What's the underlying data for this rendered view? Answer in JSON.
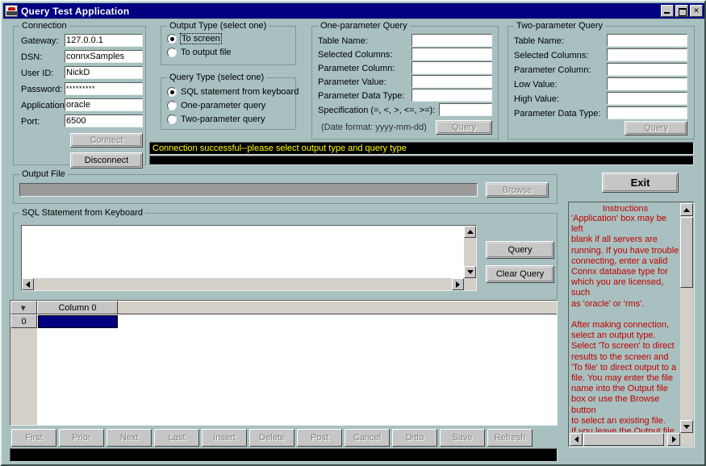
{
  "window": {
    "title": "Query Test Application",
    "icon": "app-icon",
    "buttons": {
      "minimize": "_",
      "maximize": "□",
      "close": "✕"
    }
  },
  "connection": {
    "legend": "Connection",
    "fields": [
      {
        "label": "Gateway:",
        "value": "127.0.0.1"
      },
      {
        "label": "DSN:",
        "value": "connxSamples"
      },
      {
        "label": "User ID:",
        "value": "NickD"
      },
      {
        "label": "Password:",
        "value": "*********"
      },
      {
        "label": "Application:",
        "value": "oracle"
      },
      {
        "label": "Port:",
        "value": "6500"
      }
    ],
    "connect_label": "Connect",
    "disconnect_label": "Disconnect"
  },
  "output_type": {
    "legend": "Output Type (select one)",
    "options": [
      {
        "label": "To screen",
        "checked": true,
        "focused": true
      },
      {
        "label": "To output file",
        "checked": false,
        "focused": false
      }
    ]
  },
  "query_type": {
    "legend": "Query Type (select one)",
    "options": [
      {
        "label": "SQL statement from keyboard",
        "checked": true
      },
      {
        "label": "One-parameter query",
        "checked": false
      },
      {
        "label": "Two-parameter query",
        "checked": false
      }
    ]
  },
  "one_param": {
    "legend": "One-parameter Query",
    "fields": [
      {
        "label": "Table Name:",
        "value": ""
      },
      {
        "label": "Selected Columns:",
        "value": ""
      },
      {
        "label": "Parameter Column:",
        "value": ""
      },
      {
        "label": "Parameter Value:",
        "value": ""
      },
      {
        "label": "Parameter Data Type:",
        "value": ""
      }
    ],
    "spec_label": "Specification (=, <, >, <=, >=):",
    "spec_value": "",
    "date_hint": "(Date format:  yyyy-mm-dd)",
    "query_label": "Query"
  },
  "two_param": {
    "legend": "Two-parameter Query",
    "fields": [
      {
        "label": "Table Name:",
        "value": ""
      },
      {
        "label": "Selected Columns:",
        "value": ""
      },
      {
        "label": "Parameter Column:",
        "value": ""
      },
      {
        "label": "Low Value:",
        "value": ""
      },
      {
        "label": "High Value:",
        "value": ""
      },
      {
        "label": "Parameter Data Type:",
        "value": ""
      }
    ],
    "query_label": "Query"
  },
  "status": {
    "message": "Connection successful--please select output type and query type",
    "secondary": "",
    "bottom": ""
  },
  "exit_label": "Exit",
  "output_file": {
    "legend": "Output File",
    "value": "",
    "browse_label": "Browse"
  },
  "sql_panel": {
    "legend": "SQL Statement from Keyboard",
    "value": "",
    "query_label": "Query",
    "clear_label": "Clear Query"
  },
  "instructions": {
    "title": "Instructions",
    "text": "'Application' box may be left\nblank if all servers are\nrunning.  If you have trouble\nconnecting, enter a valid\nConnx database type for\nwhich you are licensed, such\nas 'oracle' or 'rms'.\n\nAfter making connection,\nselect an output type.\nSelect 'To screen' to direct\nresults to the screen and\n'To file' to direct output to a\nfile.  You may enter the file\nname into the Output file\nbox or use the Browse button\nto select an existing file.\nIf you leave the Output file\nbox blank, output will print\nto 'temp.out' in the default",
    "color": "#c00000"
  },
  "grid": {
    "columns": [
      "Column 0"
    ],
    "rows": [
      {
        "header": "0",
        "cells": [
          ""
        ]
      }
    ],
    "selected": {
      "row": 0,
      "col": 0
    }
  },
  "nav_buttons": [
    "First",
    "Prior",
    "Next",
    "Last",
    "Insert",
    "Delete",
    "Post",
    "Cancel",
    "Ditto",
    "Save",
    "Refresh"
  ],
  "colors": {
    "face": "#a8c0c0",
    "titlebar": "#000080",
    "status_text": "#ffff00",
    "status_bg": "#000000",
    "selection": "#000080",
    "instructions": "#c00000"
  }
}
